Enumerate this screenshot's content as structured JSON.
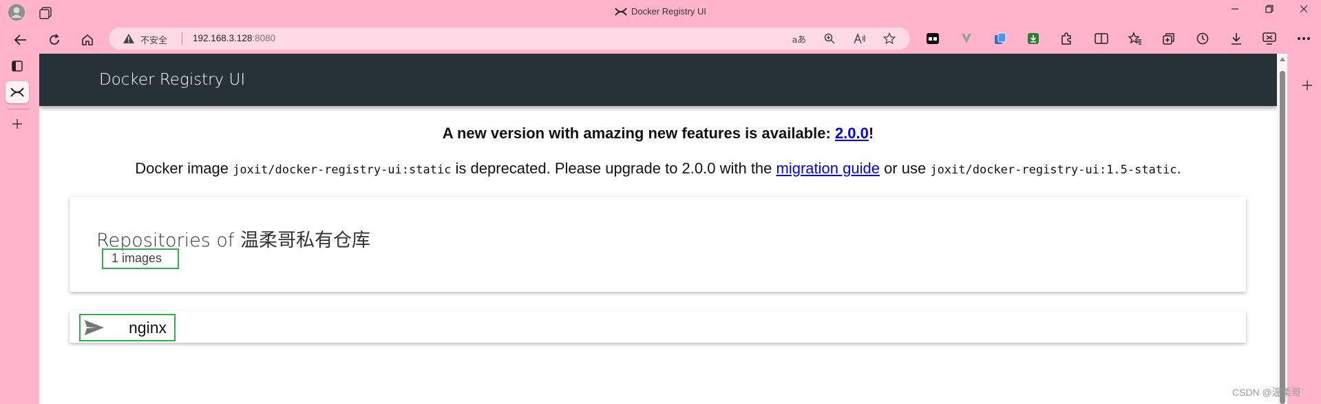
{
  "window": {
    "title": "Docker Registry UI",
    "controls": [
      "minimize-icon",
      "restore-icon",
      "close-icon"
    ]
  },
  "addressbar": {
    "security_label": "不安全",
    "url_host": "192.168.3.128",
    "url_port": ":8080",
    "read_aloud": "aあ"
  },
  "toolbar_icons": [
    "reading-mode-icon",
    "zoom-icon",
    "read-aloud-icon",
    "favorite-star-icon",
    "extension-icon",
    "extension-v-icon",
    "extension-copy-icon",
    "extension-download-icon",
    "extensions-puzzle-icon",
    "split-screen-icon",
    "favorites-icon",
    "collections-icon",
    "history-icon",
    "downloads-icon",
    "screenshot-icon",
    "more-icon"
  ],
  "app": {
    "header_title": "Docker Registry UI",
    "notice": {
      "headline_prefix": "A new version with amazing new features is available: ",
      "headline_link": "2.0.0",
      "headline_suffix": "!",
      "line_prefix": "Docker image ",
      "line_code1": "joxit/docker-registry-ui:static",
      "line_mid": " is deprecated. Please upgrade to 2.0.0 with the ",
      "line_link": "migration guide",
      "line_or": " or use ",
      "line_code2": "joxit/docker-registry-ui:1.5-static",
      "line_end": "."
    },
    "repositories": {
      "title": "Repositories of 温柔哥私有仓库",
      "count_label": "1 images",
      "items": [
        {
          "name": "nginx"
        }
      ]
    }
  },
  "watermark": "CSDN @温柔哥`",
  "colors": {
    "browser_frame": "#ffb4cc",
    "app_header": "#263238",
    "highlight_box": "#2eb34a",
    "link": "#0000ee"
  }
}
